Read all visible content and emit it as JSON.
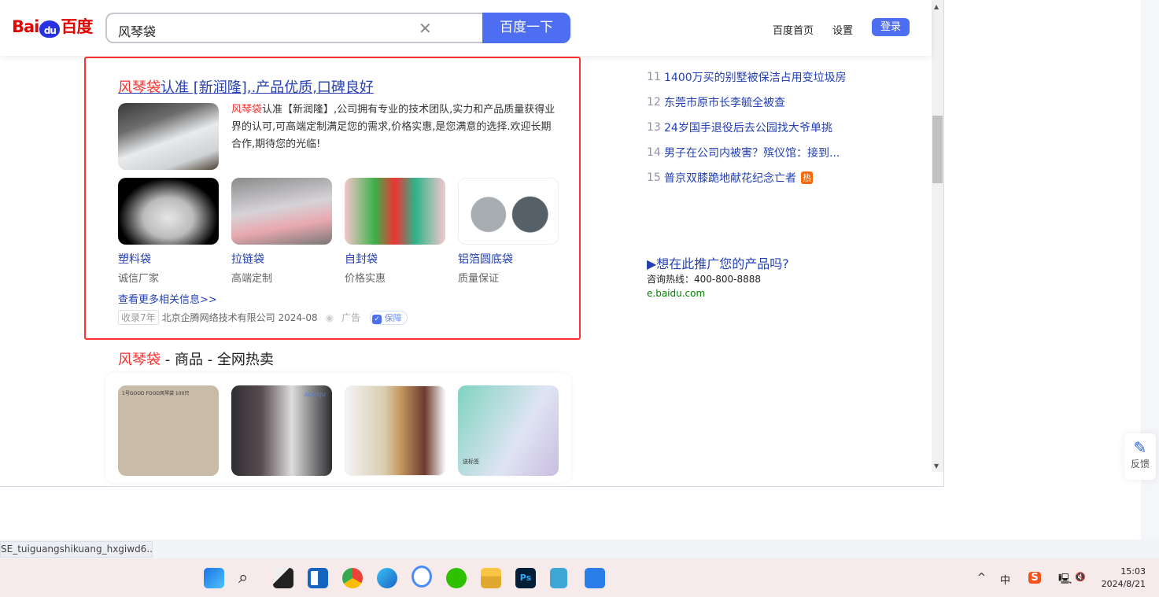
{
  "header": {
    "logo": "Bai du 百度",
    "logo_left": "Bai",
    "logo_paw": "du",
    "logo_right": "百度",
    "query": "风琴袋",
    "search_button": "百度一下",
    "links": [
      "百度首页",
      "设置"
    ],
    "login": "登录"
  },
  "ad": {
    "title_highlight": "风琴袋",
    "title_rest": "认准 [新润隆],.产品优质,口碑良好",
    "desc_highlight": "风琴袋",
    "desc_rest": "认准【新润隆】,公司拥有专业的技术团队,实力和产品质量获得业界的认可,可高端定制满足您的需求,价格实惠,是您满意的选择.欢迎长期合作,期待您的光临!",
    "products": [
      {
        "title": "塑料袋",
        "sub": "诚信厂家"
      },
      {
        "title": "拉链袋",
        "sub": "高端定制"
      },
      {
        "title": "自封袋",
        "sub": "价格实惠"
      },
      {
        "title": "铝箔圆底袋",
        "sub": "质量保证"
      }
    ],
    "more": "查看更多相关信息>>",
    "years": "收录7年",
    "company": "北京企腾网络技术有限公司 2024-08",
    "ad_label": "广告",
    "guarantee": "保障"
  },
  "section": {
    "highlight": "风琴袋",
    "rest": " - 商品 - 全网热卖",
    "image_text": [
      "1号GOOD FOOD风琴袋 100只",
      "AODEJU",
      "",
      "送标签"
    ]
  },
  "hot": [
    {
      "n": "11",
      "t": "1400万买的别墅被保洁占用变垃圾房"
    },
    {
      "n": "12",
      "t": "东莞市原市长李毓全被查"
    },
    {
      "n": "13",
      "t": "24岁国手退役后去公园找大爷单挑"
    },
    {
      "n": "14",
      "t": "男子在公司内被害？殡仪馆：接到..."
    },
    {
      "n": "15",
      "t": "普京双膝跪地献花纪念亡者",
      "badge": "热"
    }
  ],
  "promo": {
    "title": "▶想在此推广您的产品吗?",
    "phone": "咨询热线：400-800-8888",
    "url": "e.baidu.com"
  },
  "feedback": "反馈",
  "status_tip": "SE_tuiguangshikuang_hxgiwd6...",
  "tray": {
    "caret": "^",
    "ime": "中",
    "sogou": "S",
    "volume": "🔇",
    "time": "15:03",
    "date": "2024/8/21"
  },
  "colors": {
    "accent": "#4e6ef2",
    "link": "#2440b3",
    "highlight": "#f73131",
    "ad_border": "#ff3333"
  }
}
